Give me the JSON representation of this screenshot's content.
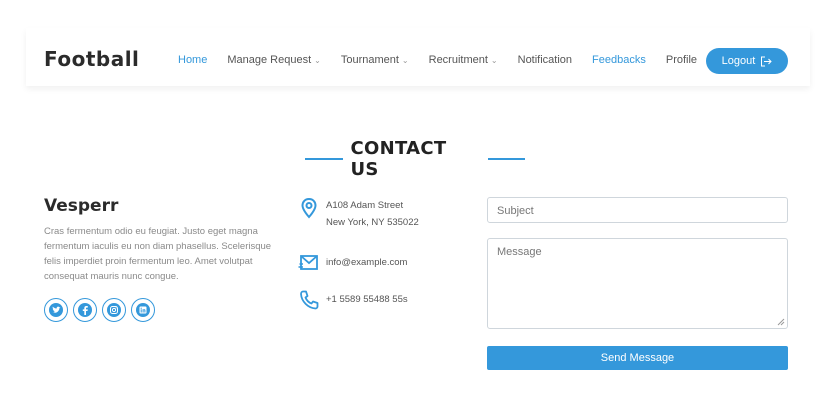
{
  "header": {
    "logo": "Football",
    "nav": [
      {
        "label": "Home",
        "dropdown": false,
        "active": true
      },
      {
        "label": "Manage Request",
        "dropdown": true,
        "active": false
      },
      {
        "label": "Tournament",
        "dropdown": true,
        "active": false
      },
      {
        "label": "Recruitment",
        "dropdown": true,
        "active": false
      },
      {
        "label": "Notification",
        "dropdown": false,
        "active": false
      },
      {
        "label": "Feedbacks",
        "dropdown": false,
        "active": true
      },
      {
        "label": "Profile",
        "dropdown": false,
        "active": false
      }
    ],
    "logout_label": "Logout"
  },
  "contact": {
    "title": "CONTACT US",
    "brand_name": "Vesperr",
    "brand_description": "Cras fermentum odio eu feugiat. Justo eget magna fermentum iaculis eu non diam phasellus. Scelerisque felis imperdiet proin fermentum leo. Amet volutpat consequat mauris nunc congue.",
    "socials": [
      "twitter-icon",
      "facebook-icon",
      "instagram-icon",
      "linkedin-icon"
    ],
    "address_line1": "A108 Adam Street",
    "address_line2": "New York, NY 535022",
    "email": "info@example.com",
    "phone": "+1 5589 55488 55s"
  },
  "form": {
    "subject_placeholder": "Subject",
    "message_placeholder": "Message",
    "send_label": "Send Message"
  },
  "colors": {
    "accent": "#3498db"
  }
}
